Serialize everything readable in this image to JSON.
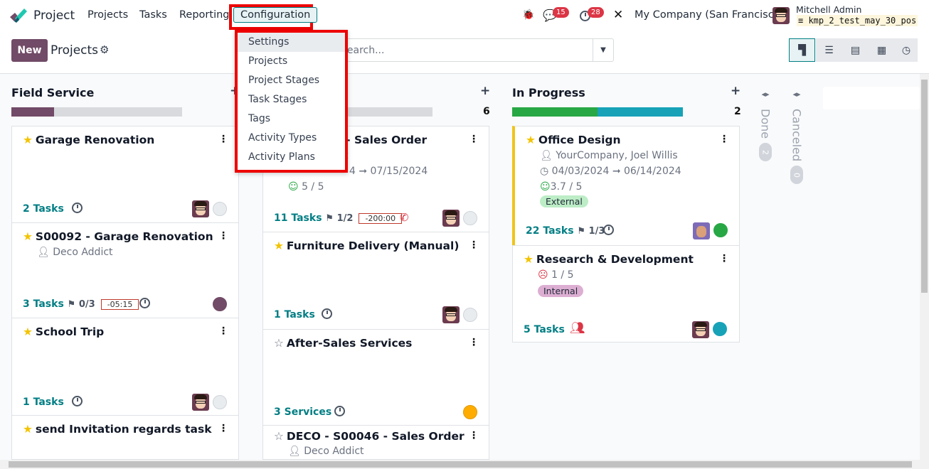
{
  "nav": {
    "app": "Project",
    "items": [
      "Projects",
      "Tasks",
      "Reporting",
      "Configuration"
    ],
    "messages_count": "15",
    "activities_count": "28",
    "company": "My Company (San Francisco)",
    "user": "Mitchell Admin",
    "database": "kmp_2_test_may_30_pos"
  },
  "control": {
    "new_label": "New",
    "title": "Projects",
    "search_placeholder": "Search..."
  },
  "views": [
    "kanban",
    "list",
    "gantt",
    "calendar",
    "activity"
  ],
  "menu": {
    "items": [
      "Settings",
      "Projects",
      "Project Stages",
      "Task Stages",
      "Tags",
      "Activity Types",
      "Activity Plans"
    ]
  },
  "columns": [
    {
      "title": "Field Service",
      "cards": [
        {
          "title": "Garage Renovation",
          "tasks": "2 Tasks"
        },
        {
          "title": "S00092 - Garage Renovation",
          "customer": "Deco Addict",
          "tasks": "3 Tasks",
          "milestones": "0/3",
          "timer": "-05:15"
        },
        {
          "title": "School Trip",
          "tasks": "1 Tasks"
        },
        {
          "title": "send Invitation regards task"
        }
      ]
    },
    {
      "title": "",
      "count": "6",
      "cards": [
        {
          "title": "4 - Sales Order",
          "customer": "t",
          "dates": "4 ➞ 07/15/2024",
          "rating": "5 / 5",
          "tasks": "11 Tasks",
          "milestones": "1/2",
          "timer": "-200:00"
        },
        {
          "title": "Furniture Delivery (Manual)",
          "tasks": "1 Tasks"
        },
        {
          "title": "After-Sales Services",
          "tasks": "3 Services"
        },
        {
          "title": "DECO - S00046 - Sales Order",
          "customer": "Deco Addict"
        }
      ]
    },
    {
      "title": "In Progress",
      "count": "2",
      "cards": [
        {
          "title": "Office Design",
          "customer": "YourCompany, Joel Willis",
          "dates": "04/03/2024 ➞ 06/14/2024",
          "rating": "3.7 / 5",
          "tag": "External",
          "tasks": "22 Tasks",
          "milestones": "1/3"
        },
        {
          "title": "Research & Development",
          "rating": "1 / 5",
          "tag": "Internal",
          "tasks": "5 Tasks"
        }
      ]
    },
    {
      "title": "Done",
      "count": "2"
    },
    {
      "title": "Canceled",
      "count": "0"
    }
  ],
  "colors": {
    "brand": "#714b67",
    "accent": "#017e84",
    "success": "#28a745",
    "info": "#17a2b8",
    "warning": "#ffac00",
    "danger": "#dc3545"
  }
}
